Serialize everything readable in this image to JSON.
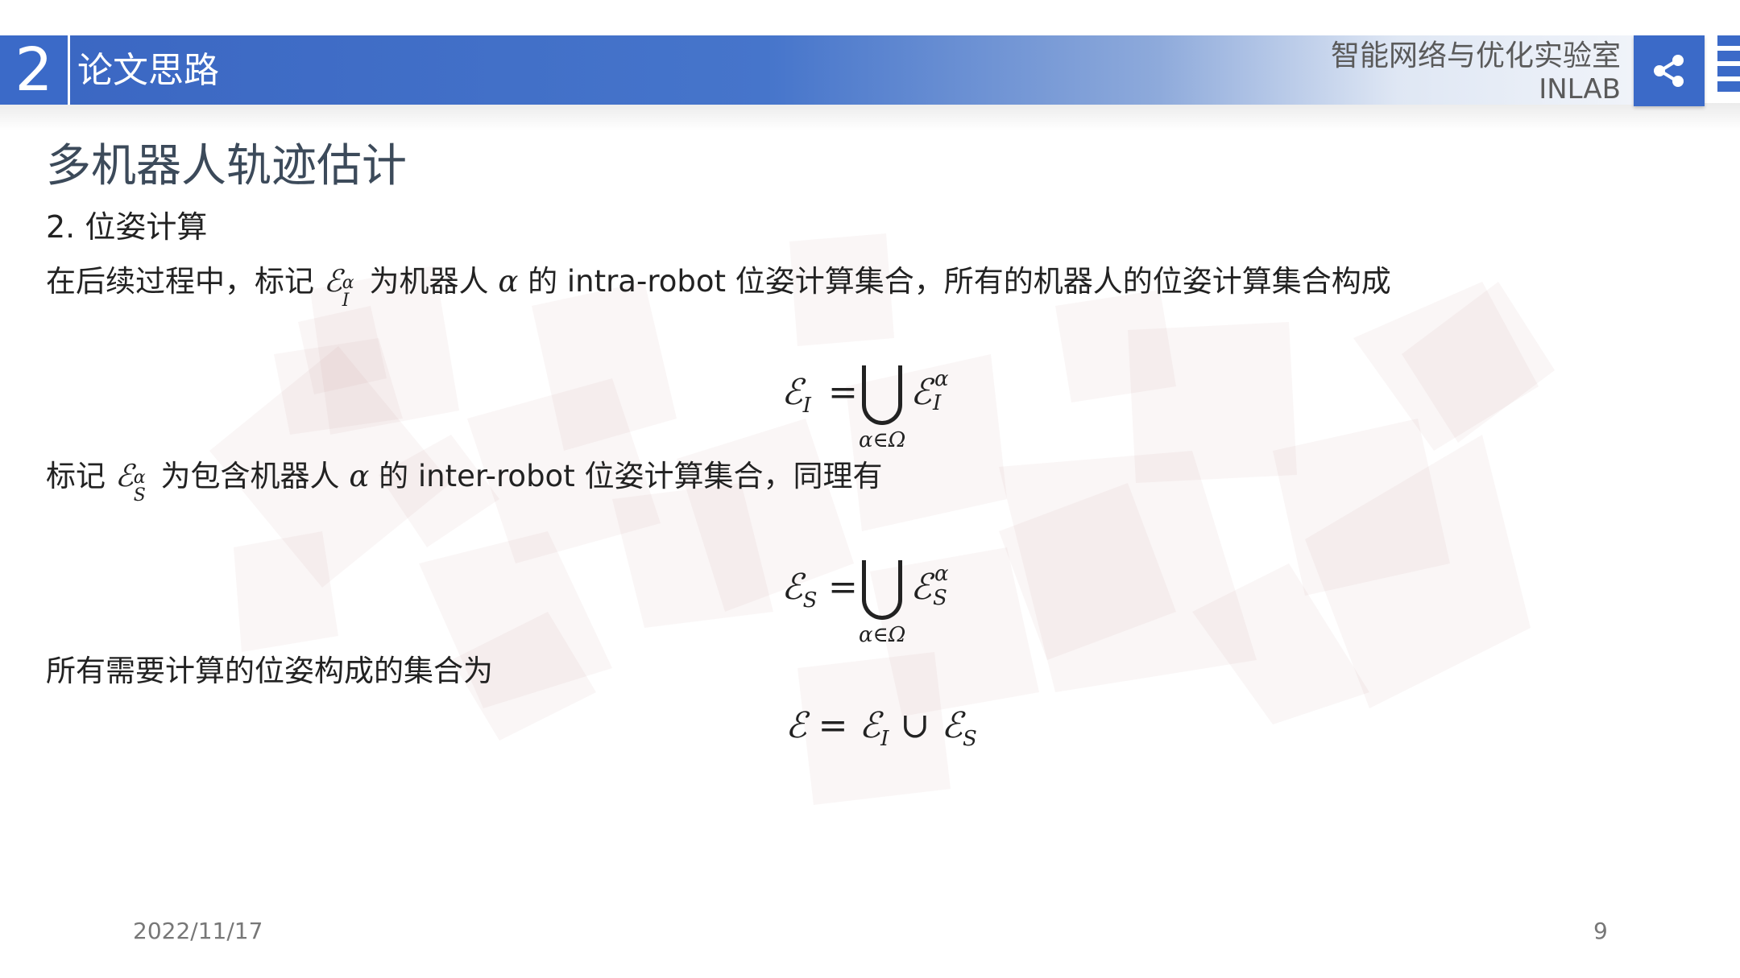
{
  "header": {
    "section_number": "2",
    "section_title": "论文思路",
    "lab_name": "智能网络与优化实验室",
    "lab_code": "INLAB",
    "share_icon": "share-icon"
  },
  "slide": {
    "title": "多机器人轨迹估计",
    "step_heading": "2. 位姿计算",
    "para1": {
      "before": "在后续过程中，标记",
      "symbol": "ℰ",
      "sup": "α",
      "sub": "I",
      "middle": "为机器人",
      "alpha": "α",
      "after": "的 intra-robot 位姿计算集合，所有的机器人的位姿计算集合构成"
    },
    "formula1": {
      "lhs_sym": "ℰ",
      "lhs_sub": "I",
      "eq": "=",
      "under": "α∈Ω",
      "rhs_sym": "ℰ",
      "rhs_sup": "α",
      "rhs_sub": "I"
    },
    "para2": {
      "before": "标记",
      "symbol": "ℰ",
      "sup": "α",
      "sub": "S",
      "middle": "为包含机器人",
      "alpha": "α",
      "after": "的 inter-robot 位姿计算集合，同理有"
    },
    "formula2": {
      "lhs_sym": "ℰ",
      "lhs_sub": "S",
      "eq": "=",
      "under": "α∈Ω",
      "rhs_sym": "ℰ",
      "rhs_sup": "α",
      "rhs_sub": "S"
    },
    "para3": "所有需要计算的位姿构成的集合为",
    "formula3": {
      "lhs": "ℰ",
      "eq": "=",
      "a": "ℰ",
      "a_sub": "I",
      "op": "∪",
      "b": "ℰ",
      "b_sub": "S"
    }
  },
  "footer": {
    "date": "2022/11/17",
    "page": "9"
  }
}
